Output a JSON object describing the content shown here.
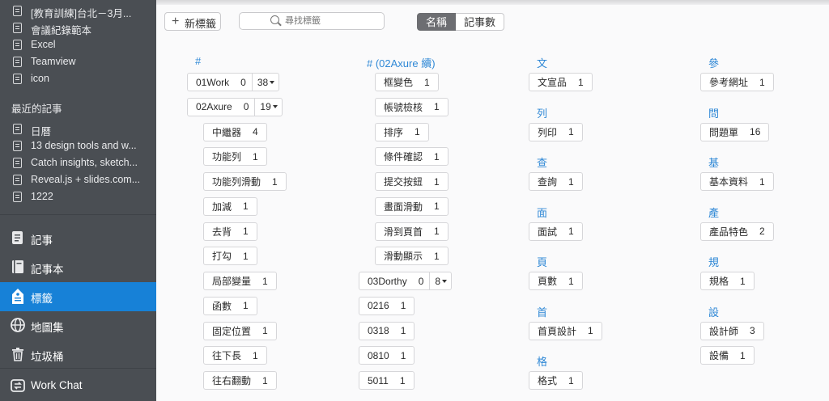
{
  "sidebar": {
    "notes_top": [
      {
        "label": "[教育訓練]台北－3月..."
      },
      {
        "label": "會議紀錄範本"
      },
      {
        "label": "Excel"
      },
      {
        "label": "Teamview"
      },
      {
        "label": "icon"
      }
    ],
    "recent_heading": "最近的記事",
    "notes_recent": [
      {
        "label": "日曆"
      },
      {
        "label": "13 design tools and w..."
      },
      {
        "label": "Catch insights, sketch..."
      },
      {
        "label": "Reveal.js + slides.com..."
      },
      {
        "label": "1222"
      }
    ],
    "nav": [
      {
        "label": "記事",
        "icon": "notes-icon"
      },
      {
        "label": "記事本",
        "icon": "notebook-icon"
      },
      {
        "label": "標籤",
        "icon": "tag-icon",
        "active": true
      },
      {
        "label": "地圖集",
        "icon": "atlas-icon"
      },
      {
        "label": "垃圾桶",
        "icon": "trash-icon"
      },
      {
        "label": "Work Chat",
        "icon": "work-chat-icon"
      }
    ]
  },
  "toolbar": {
    "new_tag_label": "新標籤",
    "search_placeholder": "尋找標籤",
    "sort_name": "名稱",
    "sort_count": "記事數"
  },
  "columns": [
    {
      "groups": [
        {
          "letter": "#",
          "tags": [
            {
              "name": "01Work",
              "count": "0",
              "sub": "38"
            },
            {
              "name": "02Axure",
              "count": "0",
              "sub": "19"
            },
            {
              "name": "中繼器",
              "count": "4",
              "indent": true
            },
            {
              "name": "功能列",
              "count": "1",
              "indent": true
            },
            {
              "name": "功能列滑動",
              "count": "1",
              "indent": true
            },
            {
              "name": "加減",
              "count": "1",
              "indent": true
            },
            {
              "name": "去背",
              "count": "1",
              "indent": true
            },
            {
              "name": "打勾",
              "count": "1",
              "indent": true
            },
            {
              "name": "局部變量",
              "count": "1",
              "indent": true
            },
            {
              "name": "函數",
              "count": "1",
              "indent": true
            },
            {
              "name": "固定位置",
              "count": "1",
              "indent": true
            },
            {
              "name": "往下長",
              "count": "1",
              "indent": true
            },
            {
              "name": "往右翻動",
              "count": "1",
              "indent": true
            }
          ]
        }
      ]
    },
    {
      "groups": [
        {
          "letter": "# (02Axure 續)",
          "tags": [
            {
              "name": "框變色",
              "count": "1",
              "indent": true
            },
            {
              "name": "帳號檢核",
              "count": "1",
              "indent": true
            },
            {
              "name": "排序",
              "count": "1",
              "indent": true
            },
            {
              "name": "條件確認",
              "count": "1",
              "indent": true
            },
            {
              "name": "提交按鈕",
              "count": "1",
              "indent": true
            },
            {
              "name": "畫面滑動",
              "count": "1",
              "indent": true
            },
            {
              "name": "滑到頁首",
              "count": "1",
              "indent": true
            },
            {
              "name": "滑動顯示",
              "count": "1",
              "indent": true
            },
            {
              "name": "03Dorthy",
              "count": "0",
              "sub": "8"
            },
            {
              "name": "0216",
              "count": "1"
            },
            {
              "name": "0318",
              "count": "1"
            },
            {
              "name": "0810",
              "count": "1"
            },
            {
              "name": "5011",
              "count": "1"
            }
          ]
        }
      ]
    },
    {
      "groups": [
        {
          "letter": "文",
          "tags": [
            {
              "name": "文宣品",
              "count": "1"
            }
          ]
        },
        {
          "letter": "列",
          "tags": [
            {
              "name": "列印",
              "count": "1"
            }
          ]
        },
        {
          "letter": "查",
          "tags": [
            {
              "name": "查詢",
              "count": "1"
            }
          ]
        },
        {
          "letter": "面",
          "tags": [
            {
              "name": "面試",
              "count": "1"
            }
          ]
        },
        {
          "letter": "頁",
          "tags": [
            {
              "name": "頁數",
              "count": "1"
            }
          ]
        },
        {
          "letter": "首",
          "tags": [
            {
              "name": "首頁設計",
              "count": "1"
            }
          ]
        },
        {
          "letter": "格",
          "tags": [
            {
              "name": "格式",
              "count": "1"
            }
          ]
        }
      ]
    },
    {
      "groups": [
        {
          "letter": "參",
          "tags": [
            {
              "name": "參考網址",
              "count": "1"
            }
          ]
        },
        {
          "letter": "問",
          "tags": [
            {
              "name": "問題單",
              "count": "16"
            }
          ]
        },
        {
          "letter": "基",
          "tags": [
            {
              "name": "基本資料",
              "count": "1"
            }
          ]
        },
        {
          "letter": "產",
          "tags": [
            {
              "name": "產品特色",
              "count": "2"
            }
          ]
        },
        {
          "letter": "規",
          "tags": [
            {
              "name": "規格",
              "count": "1"
            }
          ]
        },
        {
          "letter": "設",
          "tags": [
            {
              "name": "設計師",
              "count": "3"
            },
            {
              "name": "設備",
              "count": "1"
            }
          ]
        }
      ]
    }
  ]
}
